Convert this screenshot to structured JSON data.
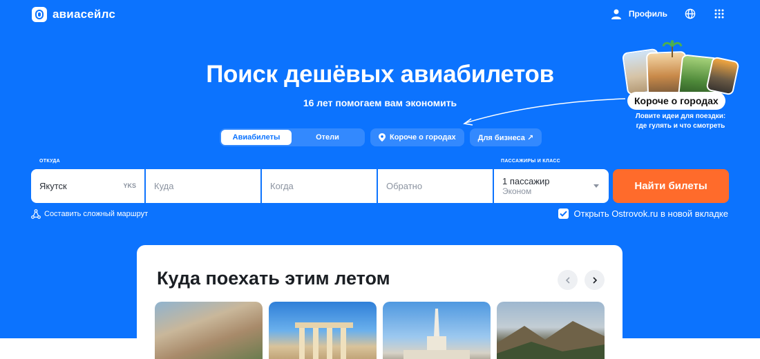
{
  "header": {
    "logo_text": "авиасейлс",
    "profile_label": "Профиль",
    "icons": [
      "user-icon",
      "globe-icon",
      "apps-grid-icon"
    ]
  },
  "hero": {
    "title": "Поиск дешёвых авиабилетов",
    "subtitle": "16 лет помогаем вам экономить"
  },
  "tabs": {
    "flights": "Авиабилеты",
    "hotels": "Отели",
    "city_guide": "Короче о городах",
    "business": "Для бизнеса ↗"
  },
  "promo": {
    "chip": "Короче о городах",
    "text_line1": "Ловите идеи для поездки:",
    "text_line2": "где гулять и что смотреть"
  },
  "search": {
    "from_label": "ОТКУДА",
    "from_value": "Якутск",
    "from_code": "YKS",
    "to_placeholder": "Куда",
    "depart_placeholder": "Когда",
    "return_placeholder": "Обратно",
    "pax_label": "ПАССАЖИРЫ И КЛАСС",
    "pax_value": "1 пассажир",
    "class_value": "Эконом",
    "find_button": "Найти билеты",
    "complex_route": "Составить сложный маршрут",
    "ostrovok_checkbox": "Открыть Ostrovok.ru в новой вкладке",
    "ostrovok_checked": true
  },
  "summer": {
    "title": "Куда поехать этим летом"
  },
  "colors": {
    "brand_blue": "#0c73fe",
    "cta_orange": "#ff6b2b"
  }
}
